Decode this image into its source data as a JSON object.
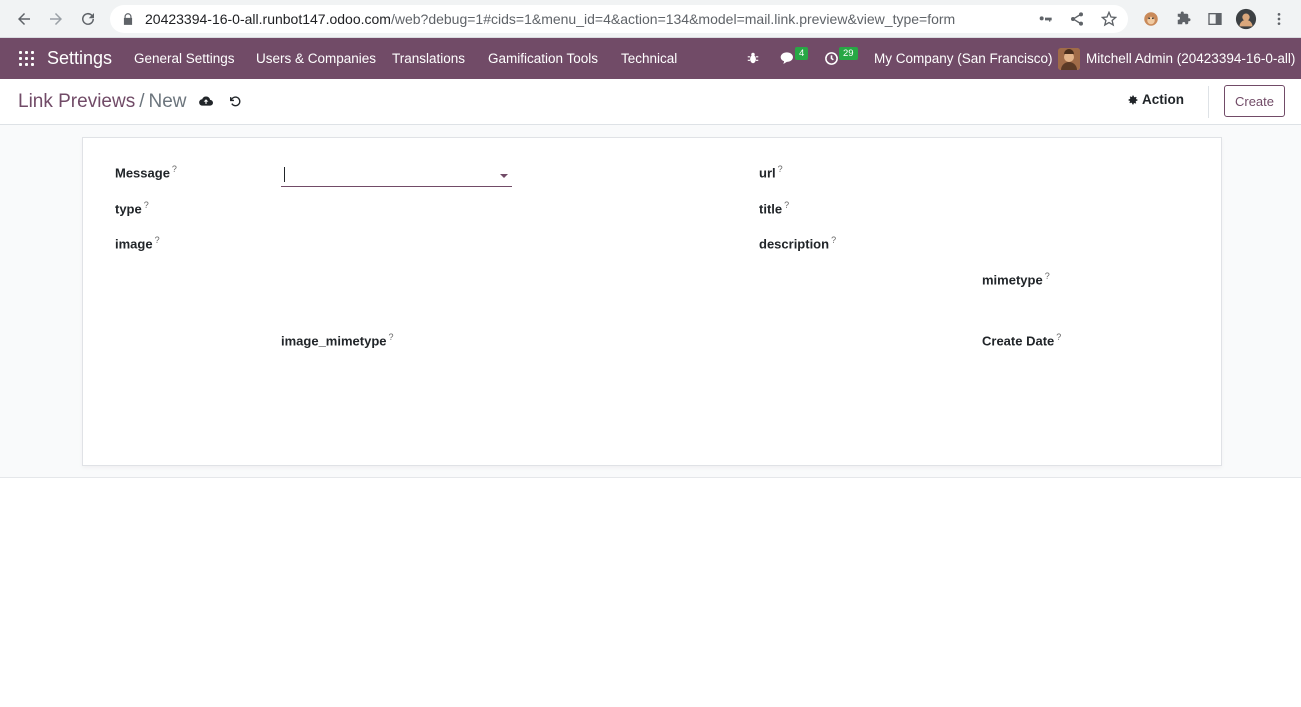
{
  "browser": {
    "url_host": "20423394-16-0-all.runbot147.odoo.com",
    "url_path": "/web?debug=1#cids=1&menu_id=4&action=134&model=mail.link.preview&view_type=form"
  },
  "navbar": {
    "app_name": "Settings",
    "menu": [
      "General Settings",
      "Users & Companies",
      "Translations",
      "Gamification Tools",
      "Technical"
    ],
    "messages_count": "4",
    "activities_count": "29",
    "company": "My Company (San Francisco)",
    "user": "Mitchell Admin (20423394-16-0-all)"
  },
  "control_panel": {
    "breadcrumb_parent": "Link Previews",
    "breadcrumb_sep": "/",
    "breadcrumb_current": "New",
    "action_label": "Action",
    "create_label": "Create"
  },
  "form": {
    "message_label": "Message",
    "type_label": "type",
    "image_label": "image",
    "url_label": "url",
    "title_label": "title",
    "description_label": "description",
    "mimetype_label": "mimetype",
    "image_mimetype_label": "image_mimetype",
    "create_date_label": "Create Date",
    "help_marker": "?"
  },
  "colors": {
    "brand": "#714b67",
    "badge": "#28a745"
  }
}
